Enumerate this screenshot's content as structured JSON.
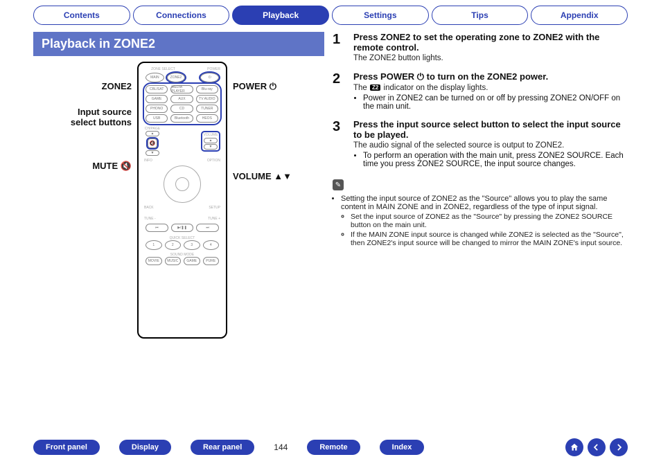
{
  "tabs": {
    "contents": "Contents",
    "connections": "Connections",
    "playback": "Playback",
    "settings": "Settings",
    "tips": "Tips",
    "appendix": "Appendix"
  },
  "heading": "Playback in ZONE2",
  "remote_labels": {
    "left_zone2": "ZONE2",
    "left_source": "Input source select buttons",
    "left_mute": "MUTE",
    "right_power": "POWER",
    "right_volume": "VOLUME"
  },
  "steps": {
    "s1": {
      "num": "1",
      "title": "Press ZONE2 to set the operating zone to ZONE2 with the remote control.",
      "desc": "The ZONE2 button lights."
    },
    "s2": {
      "num": "2",
      "title_a": "Press POWER ",
      "title_b": " to turn on the ZONE2 power.",
      "desc_a": "The ",
      "desc_badge": "Z2",
      "desc_b": " indicator on the display lights.",
      "bullet1": "Power in ZONE2 can be turned on or off by pressing ZONE2 ON/OFF on the main unit."
    },
    "s3": {
      "num": "3",
      "title": "Press the input source select button to select the input source to be played.",
      "desc": "The audio signal of the selected source is output to ZONE2.",
      "bullet1": "To perform an operation with the main unit, press ZONE2 SOURCE. Each time you press ZONE2 SOURCE, the input source changes."
    }
  },
  "notes": {
    "n1": "Setting the input source of ZONE2 as the \"Source\" allows you to play the same content in MAIN ZONE and in ZONE2, regardless of the type of input signal.",
    "n1a": "Set the input source of ZONE2 as the \"Source\" by pressing the ZONE2 SOURCE button on the main unit.",
    "n1b": "If the MAIN ZONE input source is changed while ZONE2 is selected as the \"Source\", then ZONE2's input source will be changed to mirror the MAIN ZONE's input source."
  },
  "bottom": {
    "front_panel": "Front panel",
    "display": "Display",
    "rear_panel": "Rear panel",
    "page": "144",
    "remote": "Remote",
    "index": "Index"
  },
  "glyphs": {
    "power": "⏻",
    "mute": "🔇",
    "up": "▲",
    "down": "▼"
  }
}
